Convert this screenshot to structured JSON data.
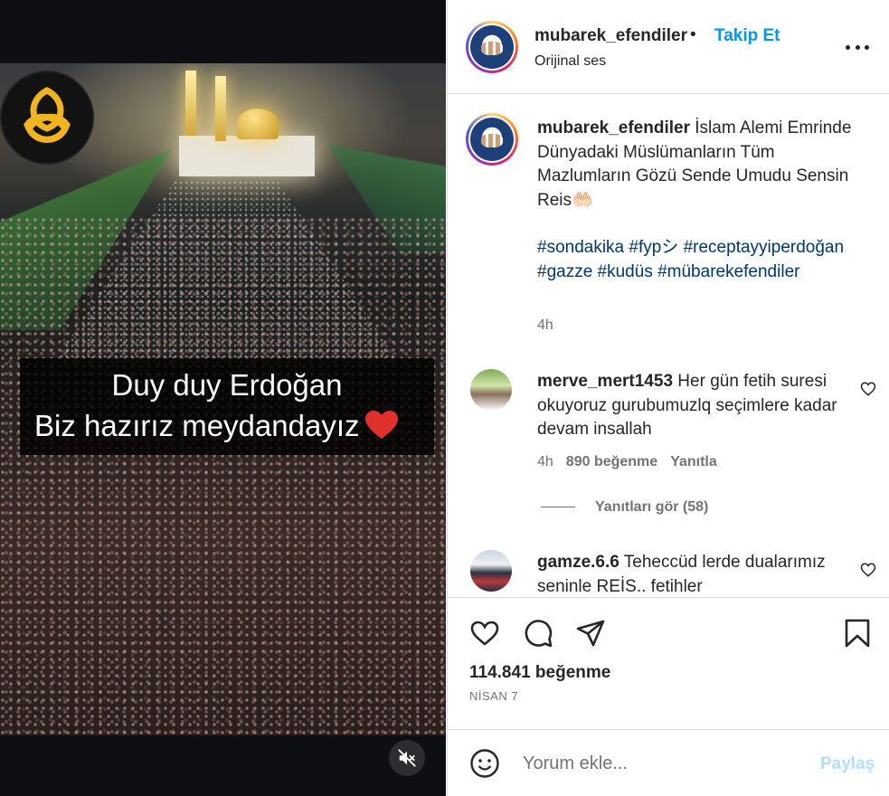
{
  "video": {
    "caption_line1": "Duy duy Erdoğan",
    "caption_line2": "Biz hazırız meydandayız"
  },
  "header": {
    "username": "mubarek_efendiler",
    "separator": "•",
    "follow_label": "Takip Et",
    "audio_label": "Orijinal ses"
  },
  "caption": {
    "username": "mubarek_efendiler",
    "text": "İslam Alemi Emrinde Dünyadaki Müslümanların Tüm Mazlumların Gözü Sende Umudu Sensin Reis🤲🏻",
    "hashtags": "#sondakika #fypシ #receptayyiperdoğan #gazze #kudüs #mübarekefendiler",
    "time": "4h"
  },
  "comments": [
    {
      "username": "merve_mert1453",
      "text": "Her gün fetih suresi okuyoruz gurubumuzlq seçimlere kadar devam insallah",
      "time": "4h",
      "likes": "890 beğenme",
      "reply_label": "Yanıtla",
      "view_replies": "Yanıtları gör (58)"
    },
    {
      "username": "gamze.6.6",
      "text": "Teheccüd lerde dualarımız seninle REİS.. fetihler"
    }
  ],
  "actions": {
    "likes_count": "114.841 beğenme",
    "date": "NİSAN 7"
  },
  "add_comment": {
    "placeholder": "Yorum ekle...",
    "post_label": "Paylaş"
  },
  "colors": {
    "accent": "#0095f6",
    "hashtag": "#00376b",
    "muted": "#737373",
    "post_disabled": "#b2dffc"
  },
  "icons": [
    "heart-icon",
    "comment-icon",
    "share-icon",
    "save-icon",
    "emoji-icon",
    "more-icon",
    "muted-speaker-icon",
    "red-heart-icon"
  ]
}
